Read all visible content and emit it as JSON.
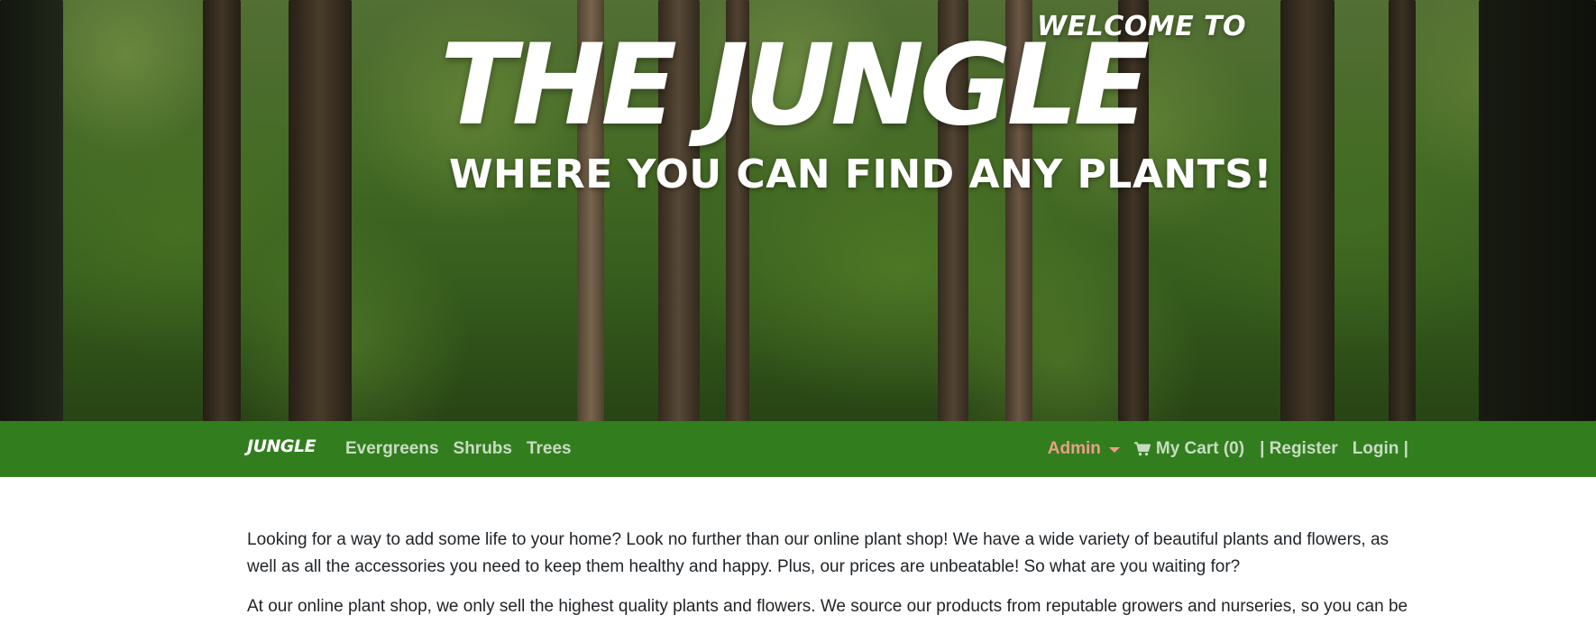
{
  "hero": {
    "welcome": "WELCOME TO",
    "title": "THE JUNGLE",
    "subtitle": "WHERE YOU CAN FIND ANY PLANTS!"
  },
  "navbar": {
    "brand": "JUNGLE",
    "links": [
      "Evergreens",
      "Shrubs",
      "Trees"
    ],
    "admin_label": "Admin",
    "cart_label": "My Cart (0)",
    "register_label": "| Register",
    "login_label": "Login |"
  },
  "content": {
    "paragraphs": [
      "Looking for a way to add some life to your home? Look no further than our online plant shop! We have a wide variety of beautiful plants and flowers, as well as all the accessories you need to keep them healthy and happy. Plus, our prices are unbeatable! So what are you waiting for?",
      "At our online plant shop, we only sell the highest quality plants and flowers. We source our products from reputable growers and nurseries, so you can be"
    ]
  },
  "colors": {
    "navbar_bg": "#327e1f",
    "nav_link": "#c9dcc3",
    "admin_accent": "#ee9d86",
    "text": "#212529"
  },
  "icons": {
    "cart": "shopping-cart-icon",
    "admin_dropdown": "caret-down-icon"
  }
}
